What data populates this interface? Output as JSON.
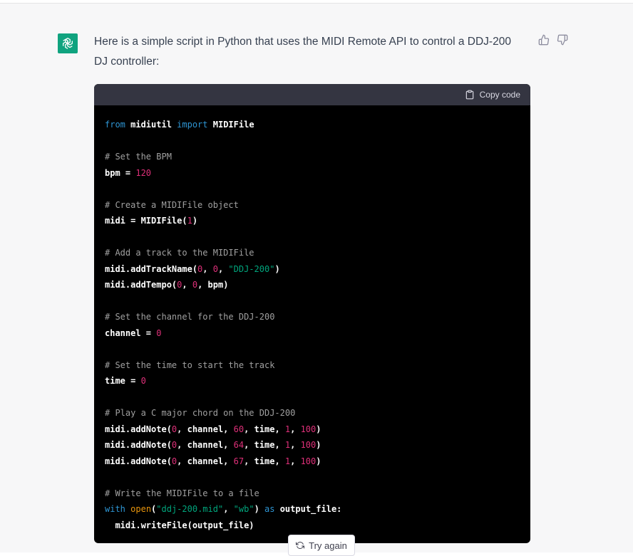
{
  "message": {
    "intro": "Here is a simple script in Python that uses the MIDI Remote API to control a DDJ-200 DJ controller:"
  },
  "code_block": {
    "copy_label": "Copy code",
    "lines": [
      [
        [
          "kw",
          "from"
        ],
        [
          "t",
          " midiutil "
        ],
        [
          "kw",
          "import"
        ],
        [
          "t",
          " MIDIFile"
        ]
      ],
      [],
      [
        [
          "cm",
          "# Set the BPM"
        ]
      ],
      [
        [
          "t",
          "bpm = "
        ],
        [
          "num",
          "120"
        ]
      ],
      [],
      [
        [
          "cm",
          "# Create a MIDIFile object"
        ]
      ],
      [
        [
          "t",
          "midi = MIDIFile("
        ],
        [
          "num",
          "1"
        ],
        [
          "t",
          ")"
        ]
      ],
      [],
      [
        [
          "cm",
          "# Add a track to the MIDIFile"
        ]
      ],
      [
        [
          "t",
          "midi.addTrackName("
        ],
        [
          "num",
          "0"
        ],
        [
          "t",
          ", "
        ],
        [
          "num",
          "0"
        ],
        [
          "t",
          ", "
        ],
        [
          "str",
          "\"DDJ-200\""
        ],
        [
          "t",
          ")"
        ]
      ],
      [
        [
          "t",
          "midi.addTempo("
        ],
        [
          "num",
          "0"
        ],
        [
          "t",
          ", "
        ],
        [
          "num",
          "0"
        ],
        [
          "t",
          ", bpm)"
        ]
      ],
      [],
      [
        [
          "cm",
          "# Set the channel for the DDJ-200"
        ]
      ],
      [
        [
          "t",
          "channel = "
        ],
        [
          "num",
          "0"
        ]
      ],
      [],
      [
        [
          "cm",
          "# Set the time to start the track"
        ]
      ],
      [
        [
          "t",
          "time = "
        ],
        [
          "num",
          "0"
        ]
      ],
      [],
      [
        [
          "cm",
          "# Play a C major chord on the DDJ-200"
        ]
      ],
      [
        [
          "t",
          "midi.addNote("
        ],
        [
          "num",
          "0"
        ],
        [
          "t",
          ", channel, "
        ],
        [
          "num",
          "60"
        ],
        [
          "t",
          ", time, "
        ],
        [
          "num",
          "1"
        ],
        [
          "t",
          ", "
        ],
        [
          "num",
          "100"
        ],
        [
          "t",
          ")"
        ]
      ],
      [
        [
          "t",
          "midi.addNote("
        ],
        [
          "num",
          "0"
        ],
        [
          "t",
          ", channel, "
        ],
        [
          "num",
          "64"
        ],
        [
          "t",
          ", time, "
        ],
        [
          "num",
          "1"
        ],
        [
          "t",
          ", "
        ],
        [
          "num",
          "100"
        ],
        [
          "t",
          ")"
        ]
      ],
      [
        [
          "t",
          "midi.addNote("
        ],
        [
          "num",
          "0"
        ],
        [
          "t",
          ", channel, "
        ],
        [
          "num",
          "67"
        ],
        [
          "t",
          ", time, "
        ],
        [
          "num",
          "1"
        ],
        [
          "t",
          ", "
        ],
        [
          "num",
          "100"
        ],
        [
          "t",
          ")"
        ]
      ],
      [],
      [
        [
          "cm",
          "# Write the MIDIFile to a file"
        ]
      ],
      [
        [
          "kw",
          "with"
        ],
        [
          "t",
          " "
        ],
        [
          "bi",
          "open"
        ],
        [
          "t",
          "("
        ],
        [
          "str",
          "\"ddj-200.mid\""
        ],
        [
          "t",
          ", "
        ],
        [
          "str",
          "\"wb\""
        ],
        [
          "t",
          ") "
        ],
        [
          "kw",
          "as"
        ],
        [
          "t",
          " output_file:"
        ]
      ],
      [
        [
          "t",
          "  midi.writeFile(output_file)"
        ]
      ]
    ]
  },
  "actions": {
    "try_again_label": "Try again"
  },
  "icons": {
    "avatar": "openai-logo-icon",
    "thumbs_up": "thumbs-up-icon",
    "thumbs_down": "thumbs-down-icon",
    "copy": "clipboard-icon",
    "regenerate": "refresh-icon"
  },
  "colors": {
    "avatar_bg": "#10a37f",
    "keyword": "#2e95d3",
    "number": "#df3079",
    "string": "#00a67d",
    "comment": "#a0a0a0"
  }
}
